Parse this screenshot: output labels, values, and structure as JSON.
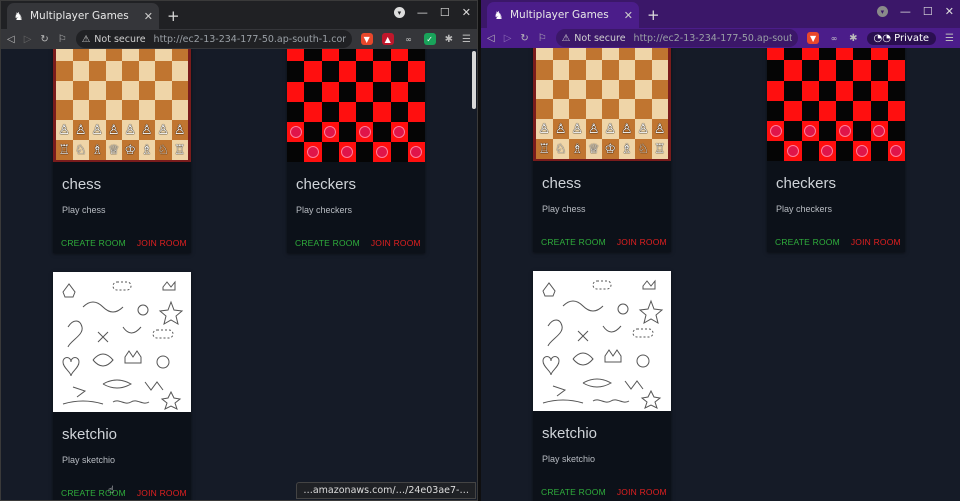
{
  "left_window": {
    "tab_title": "Multiplayer Games",
    "not_secure": "Not secure",
    "url": "http://ec2-13-234-177-50.ap-south-1.com...",
    "status_url": "…amazonaws.com/…/24e03ae7-…"
  },
  "right_window": {
    "tab_title": "Multiplayer Games",
    "not_secure": "Not secure",
    "url": "http://ec2-13-234-177-50.ap-sout...",
    "private_label": "Private"
  },
  "games": [
    {
      "name": "chess",
      "desc": "Play chess",
      "create": "CREATE ROOM",
      "join": "JOIN ROOM"
    },
    {
      "name": "checkers",
      "desc": "Play checkers",
      "create": "CREATE ROOM",
      "join": "JOIN ROOM"
    },
    {
      "name": "sketchio",
      "desc": "Play sketchio",
      "create": "CREATE ROOM",
      "join": "JOIN ROOM"
    }
  ],
  "colors": {
    "page_bg": "#151b27",
    "card_bg": "#0c1119",
    "create_color": "#2fae3c",
    "join_color": "#e02020",
    "private_theme": "#4b1d8a"
  }
}
